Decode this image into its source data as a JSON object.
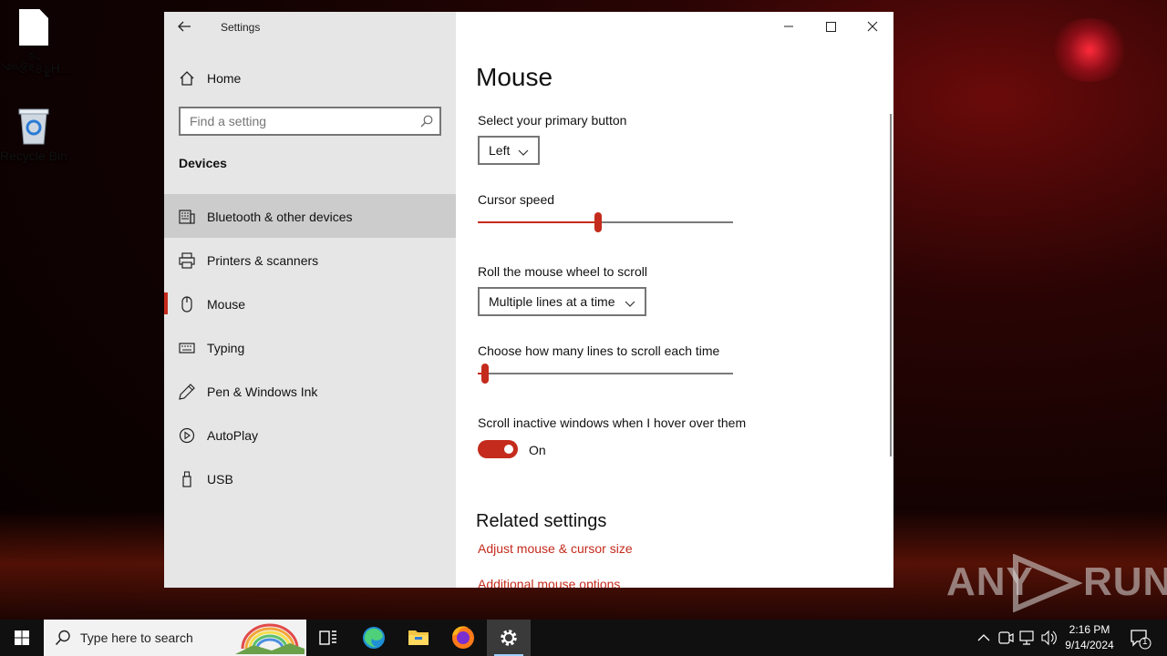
{
  "desktop": {
    "icons": [
      {
        "label": "ঙ৲ ༇ঔৎ৪ৡৢH..."
      },
      {
        "label": "Recycle Bin"
      }
    ]
  },
  "window": {
    "title": "Settings",
    "sidebar": {
      "home_label": "Home",
      "search_placeholder": "Find a setting",
      "section_heading": "Devices",
      "items": [
        {
          "label": "Bluetooth & other devices",
          "icon": "keyboard-device-icon"
        },
        {
          "label": "Printers & scanners",
          "icon": "printer-icon"
        },
        {
          "label": "Mouse",
          "icon": "mouse-icon"
        },
        {
          "label": "Typing",
          "icon": "keyboard-icon"
        },
        {
          "label": "Pen & Windows Ink",
          "icon": "pen-icon"
        },
        {
          "label": "AutoPlay",
          "icon": "autoplay-icon"
        },
        {
          "label": "USB",
          "icon": "usb-icon"
        }
      ],
      "selected": "Mouse",
      "hovered": "Bluetooth & other devices"
    },
    "main": {
      "title": "Mouse",
      "primary_button_label": "Select your primary button",
      "primary_button_value": "Left",
      "cursor_speed_label": "Cursor speed",
      "cursor_speed_fraction": 0.47,
      "scroll_label": "Roll the mouse wheel to scroll",
      "scroll_value": "Multiple lines at a time",
      "lines_label": "Choose how many lines to scroll each time",
      "lines_fraction": 0.03,
      "inactive_label": "Scroll inactive windows when I hover over them",
      "inactive_state": "On",
      "related_heading": "Related settings",
      "links": [
        "Adjust mouse & cursor size",
        "Additional mouse options"
      ]
    }
  },
  "watermark": {
    "left": "ANY",
    "right": "RUN"
  },
  "taskbar": {
    "search_placeholder": "Type here to search",
    "time": "2:16 PM",
    "date": "9/14/2024",
    "notification_count": "1"
  },
  "colors": {
    "accent": "#c42b1c",
    "sidebar_bg": "#e6e6e6",
    "selected_bg": "#cccccc"
  }
}
